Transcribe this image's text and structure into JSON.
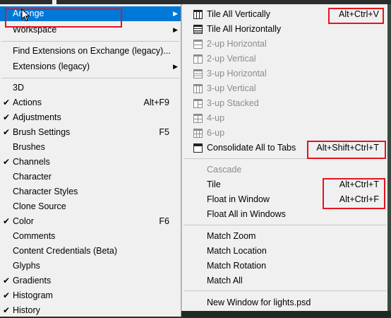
{
  "left_menu": {
    "items": [
      {
        "label": "Arrange",
        "check": "",
        "shortcut": "",
        "submenu": true,
        "highlight": true
      },
      {
        "label": "Workspace",
        "check": "",
        "shortcut": "",
        "submenu": true
      },
      {
        "label": "Find Extensions on Exchange (legacy)...",
        "check": "",
        "shortcut": ""
      },
      {
        "label": "Extensions (legacy)",
        "check": "",
        "shortcut": "",
        "submenu": true
      },
      {
        "label": "3D",
        "check": "",
        "shortcut": ""
      },
      {
        "label": "Actions",
        "check": "✔",
        "shortcut": "Alt+F9"
      },
      {
        "label": "Adjustments",
        "check": "✔",
        "shortcut": ""
      },
      {
        "label": "Brush Settings",
        "check": "✔",
        "shortcut": "F5"
      },
      {
        "label": "Brushes",
        "check": "",
        "shortcut": ""
      },
      {
        "label": "Channels",
        "check": "✔",
        "shortcut": ""
      },
      {
        "label": "Character",
        "check": "",
        "shortcut": ""
      },
      {
        "label": "Character Styles",
        "check": "",
        "shortcut": ""
      },
      {
        "label": "Clone Source",
        "check": "",
        "shortcut": ""
      },
      {
        "label": "Color",
        "check": "✔",
        "shortcut": "F6"
      },
      {
        "label": "Comments",
        "check": "",
        "shortcut": ""
      },
      {
        "label": "Content Credentials (Beta)",
        "check": "",
        "shortcut": ""
      },
      {
        "label": "Glyphs",
        "check": "",
        "shortcut": ""
      },
      {
        "label": "Gradients",
        "check": "✔",
        "shortcut": ""
      },
      {
        "label": "Histogram",
        "check": "✔",
        "shortcut": ""
      },
      {
        "label": "History",
        "check": "✔",
        "shortcut": ""
      }
    ]
  },
  "arrange_menu": {
    "items": [
      {
        "label": "Tile All Vertically",
        "shortcut": "Alt+Ctrl+V",
        "icon": "tile-vertical-icon",
        "disabled": false
      },
      {
        "label": "Tile All Horizontally",
        "shortcut": "",
        "icon": "tile-horizontal-icon",
        "disabled": false
      },
      {
        "label": "2-up Horizontal",
        "shortcut": "",
        "icon": "2up-horizontal-icon",
        "disabled": true
      },
      {
        "label": "2-up Vertical",
        "shortcut": "",
        "icon": "2up-vertical-icon",
        "disabled": true
      },
      {
        "label": "3-up Horizontal",
        "shortcut": "",
        "icon": "3up-horizontal-icon",
        "disabled": true
      },
      {
        "label": "3-up Vertical",
        "shortcut": "",
        "icon": "3up-vertical-icon",
        "disabled": true
      },
      {
        "label": "3-up Stacked",
        "shortcut": "",
        "icon": "3up-stacked-icon",
        "disabled": true
      },
      {
        "label": "4-up",
        "shortcut": "",
        "icon": "4up-icon",
        "disabled": true
      },
      {
        "label": "6-up",
        "shortcut": "",
        "icon": "6up-icon",
        "disabled": true
      },
      {
        "label": "Consolidate All to Tabs",
        "shortcut": "Alt+Shift+Ctrl+T",
        "icon": "consolidate-tabs-icon",
        "disabled": false
      },
      {
        "label": "Cascade",
        "shortcut": "",
        "icon": "",
        "disabled": true
      },
      {
        "label": "Tile",
        "shortcut": "Alt+Ctrl+T",
        "icon": "",
        "disabled": false
      },
      {
        "label": "Float in Window",
        "shortcut": "Alt+Ctrl+F",
        "icon": "",
        "disabled": false
      },
      {
        "label": "Float All in Windows",
        "shortcut": "",
        "icon": "",
        "disabled": false
      },
      {
        "label": "Match Zoom",
        "shortcut": "",
        "icon": "",
        "disabled": false
      },
      {
        "label": "Match Location",
        "shortcut": "",
        "icon": "",
        "disabled": false
      },
      {
        "label": "Match Rotation",
        "shortcut": "",
        "icon": "",
        "disabled": false
      },
      {
        "label": "Match All",
        "shortcut": "",
        "icon": "",
        "disabled": false
      },
      {
        "label": "New Window for lights.psd",
        "shortcut": "",
        "icon": "",
        "disabled": false
      }
    ]
  },
  "colors": {
    "highlight": "#0078d7",
    "annotation": "#e3141e",
    "disabled": "#8c8c8c"
  }
}
